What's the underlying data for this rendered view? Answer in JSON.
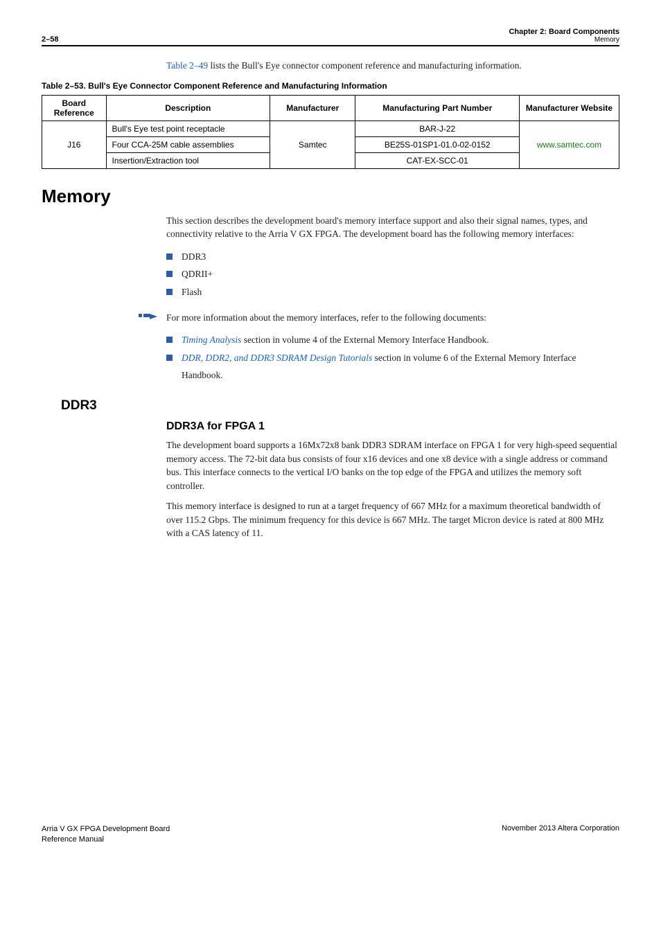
{
  "header": {
    "page_num": "2–58",
    "chapter": "Chapter 2: Board Components",
    "section_sub": "Memory"
  },
  "intro": {
    "ref": "Table 2–49",
    "rest": " lists the Bull's Eye connector component reference and manufacturing information."
  },
  "table_caption": "Table 2–53.  Bull's Eye Connector Component Reference and Manufacturing Information",
  "table": {
    "headers": [
      "Board Reference",
      "Description",
      "Manufacturer",
      "Manufacturing Part Number",
      "Manufacturer Website"
    ],
    "board_ref": "J16",
    "manufacturer": "Samtec",
    "website": "www.samtec.com",
    "rows": [
      {
        "desc": "Bull's Eye test point receptacle",
        "part": "BAR-J-22"
      },
      {
        "desc": "Four CCA-25M cable assemblies",
        "part": "BE25S-01SP1-01.0-02-0152"
      },
      {
        "desc": "Insertion/Extraction tool",
        "part": "CAT-EX-SCC-01"
      }
    ]
  },
  "memory": {
    "title": "Memory",
    "para": "This section describes the development board's memory interface support and also their signal names, types, and connectivity relative to the Arria V GX FPGA. The development board has the following memory interfaces:",
    "bullets": [
      "DDR3",
      "QDRII+",
      "Flash"
    ],
    "note": "For more information about the memory interfaces, refer to the following documents:",
    "docs": [
      {
        "link": "Timing Analysis",
        "rest": " section in volume 4 of the External Memory Interface Handbook."
      },
      {
        "link": "DDR, DDR2, and DDR3 SDRAM Design Tutorials",
        "rest": " section in volume 6 of the External Memory Interface Handbook."
      }
    ]
  },
  "ddr3": {
    "title": "DDR3",
    "subtitle": "DDR3A for FPGA 1",
    "p1": "The development board supports a 16Mx72x8 bank DDR3 SDRAM interface on FPGA 1 for very high-speed sequential memory access. The 72-bit data bus consists of four x16 devices and one x8 device with a single address or command bus. This interface connects to the vertical I/O banks on the top edge of the FPGA and utilizes the memory soft controller.",
    "p2": "This memory interface is designed to run at a target frequency of 667 MHz for a maximum theoretical bandwidth of over 115.2 Gbps. The minimum frequency for this device is 667 MHz. The target Micron device is rated at 800 MHz with a CAS latency of 11."
  },
  "footer": {
    "left1": "Arria V GX FPGA Development Board",
    "left2": "Reference Manual",
    "right": "November 2013   Altera Corporation"
  }
}
